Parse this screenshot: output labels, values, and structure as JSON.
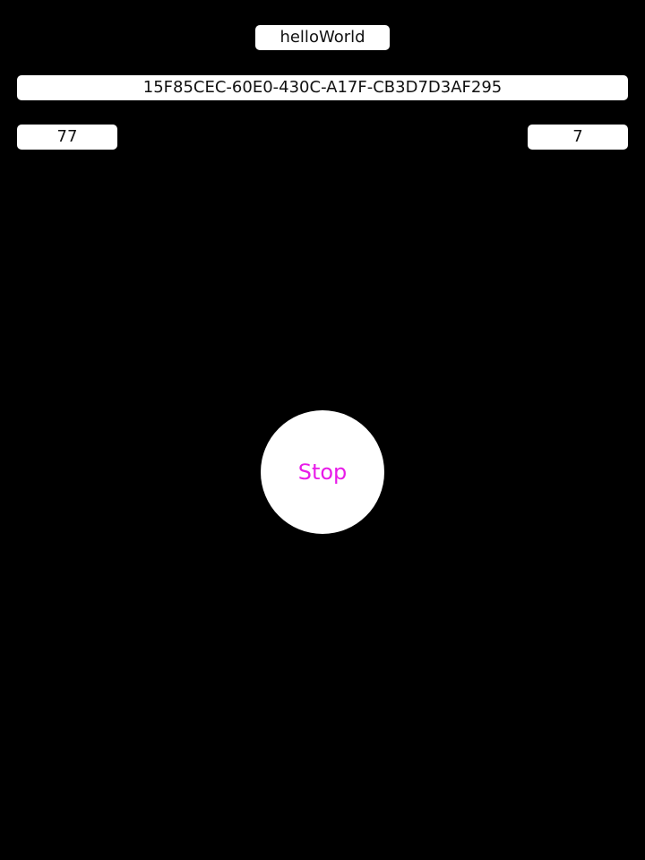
{
  "fields": {
    "name": "helloWorld",
    "uuid": "15F85CEC-60E0-430C-A17F-CB3D7D3AF295",
    "left_value": "77",
    "right_value": "7"
  },
  "stop_button": {
    "label": "Stop"
  },
  "colors": {
    "background": "#000000",
    "field_background": "#ffffff",
    "field_text": "#111111",
    "button_text": "#e81be8"
  }
}
